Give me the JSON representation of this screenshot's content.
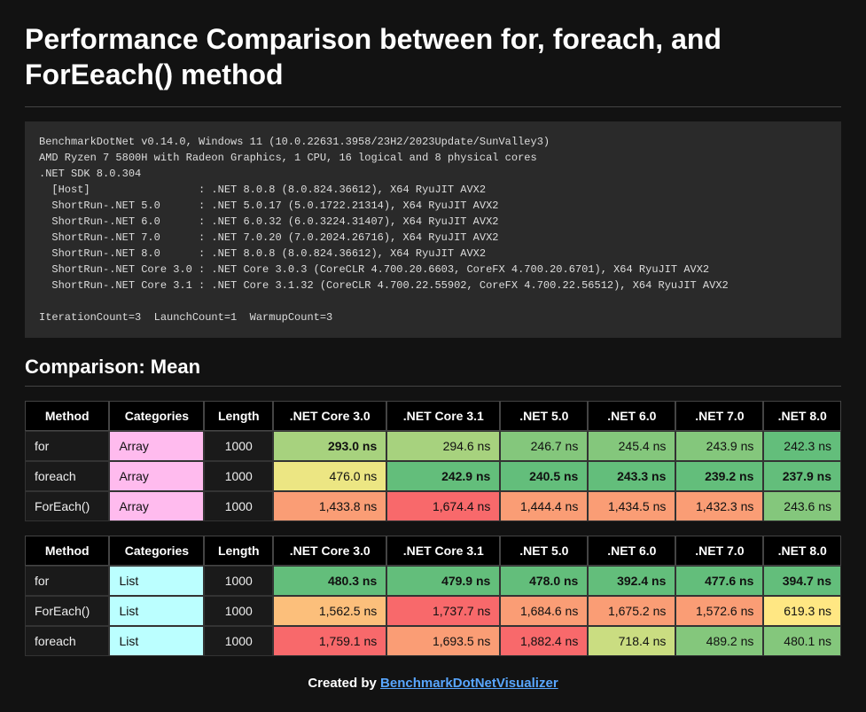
{
  "title": "Performance Comparison between for, foreach, and ForEeach() method",
  "environment_text": "BenchmarkDotNet v0.14.0, Windows 11 (10.0.22631.3958/23H2/2023Update/SunValley3)\nAMD Ryzen 7 5800H with Radeon Graphics, 1 CPU, 16 logical and 8 physical cores\n.NET SDK 8.0.304\n  [Host]                 : .NET 8.0.8 (8.0.824.36612), X64 RyuJIT AVX2\n  ShortRun-.NET 5.0      : .NET 5.0.17 (5.0.1722.21314), X64 RyuJIT AVX2\n  ShortRun-.NET 6.0      : .NET 6.0.32 (6.0.3224.31407), X64 RyuJIT AVX2\n  ShortRun-.NET 7.0      : .NET 7.0.20 (7.0.2024.26716), X64 RyuJIT AVX2\n  ShortRun-.NET 8.0      : .NET 8.0.8 (8.0.824.36612), X64 RyuJIT AVX2\n  ShortRun-.NET Core 3.0 : .NET Core 3.0.3 (CoreCLR 4.700.20.6603, CoreFX 4.700.20.6701), X64 RyuJIT AVX2\n  ShortRun-.NET Core 3.1 : .NET Core 3.1.32 (CoreCLR 4.700.22.55902, CoreFX 4.700.22.56512), X64 RyuJIT AVX2\n\nIterationCount=3  LaunchCount=1  WarmupCount=3",
  "comparison_heading": "Comparison: Mean",
  "headers": {
    "method": "Method",
    "categories": "Categories",
    "length": "Length",
    "runtimes": [
      ".NET Core 3.0",
      ".NET Core 3.1",
      ".NET 5.0",
      ".NET 6.0",
      ".NET 7.0",
      ".NET 8.0"
    ]
  },
  "colors": {
    "heat": [
      "#63be7b",
      "#84c77c",
      "#a7d27e",
      "#cadd81",
      "#ece683",
      "#ffe783",
      "#fcbf7b",
      "#fa9d75",
      "#f8696b"
    ]
  },
  "tables": [
    {
      "category_class": "cat-array",
      "rows": [
        {
          "method": "for",
          "category": "Array",
          "length": "1000",
          "cells": [
            {
              "text": "293.0 ns",
              "bold": true,
              "heat": 2
            },
            {
              "text": "294.6 ns",
              "bold": false,
              "heat": 2
            },
            {
              "text": "246.7 ns",
              "bold": false,
              "heat": 1
            },
            {
              "text": "245.4 ns",
              "bold": false,
              "heat": 1
            },
            {
              "text": "243.9 ns",
              "bold": false,
              "heat": 1
            },
            {
              "text": "242.3 ns",
              "bold": false,
              "heat": 0
            }
          ]
        },
        {
          "method": "foreach",
          "category": "Array",
          "length": "1000",
          "cells": [
            {
              "text": "476.0 ns",
              "bold": false,
              "heat": 4
            },
            {
              "text": "242.9 ns",
              "bold": true,
              "heat": 0
            },
            {
              "text": "240.5 ns",
              "bold": true,
              "heat": 0
            },
            {
              "text": "243.3 ns",
              "bold": true,
              "heat": 0
            },
            {
              "text": "239.2 ns",
              "bold": true,
              "heat": 0
            },
            {
              "text": "237.9 ns",
              "bold": true,
              "heat": 0
            }
          ]
        },
        {
          "method": "ForEach()",
          "category": "Array",
          "length": "1000",
          "cells": [
            {
              "text": "1,433.8 ns",
              "bold": false,
              "heat": 7
            },
            {
              "text": "1,674.4 ns",
              "bold": false,
              "heat": 8
            },
            {
              "text": "1,444.4 ns",
              "bold": false,
              "heat": 7
            },
            {
              "text": "1,434.5 ns",
              "bold": false,
              "heat": 7
            },
            {
              "text": "1,432.3 ns",
              "bold": false,
              "heat": 7
            },
            {
              "text": "243.6 ns",
              "bold": false,
              "heat": 1
            }
          ]
        }
      ]
    },
    {
      "category_class": "cat-list",
      "rows": [
        {
          "method": "for",
          "category": "List",
          "length": "1000",
          "cells": [
            {
              "text": "480.3 ns",
              "bold": true,
              "heat": 0
            },
            {
              "text": "479.9 ns",
              "bold": true,
              "heat": 0
            },
            {
              "text": "478.0 ns",
              "bold": true,
              "heat": 0
            },
            {
              "text": "392.4 ns",
              "bold": true,
              "heat": 0
            },
            {
              "text": "477.6 ns",
              "bold": true,
              "heat": 0
            },
            {
              "text": "394.7 ns",
              "bold": true,
              "heat": 0
            }
          ]
        },
        {
          "method": "ForEach()",
          "category": "List",
          "length": "1000",
          "cells": [
            {
              "text": "1,562.5 ns",
              "bold": false,
              "heat": 6
            },
            {
              "text": "1,737.7 ns",
              "bold": false,
              "heat": 8
            },
            {
              "text": "1,684.6 ns",
              "bold": false,
              "heat": 7
            },
            {
              "text": "1,675.2 ns",
              "bold": false,
              "heat": 7
            },
            {
              "text": "1,572.6 ns",
              "bold": false,
              "heat": 7
            },
            {
              "text": "619.3 ns",
              "bold": false,
              "heat": 5
            }
          ]
        },
        {
          "method": "foreach",
          "category": "List",
          "length": "1000",
          "cells": [
            {
              "text": "1,759.1 ns",
              "bold": false,
              "heat": 8
            },
            {
              "text": "1,693.5 ns",
              "bold": false,
              "heat": 7
            },
            {
              "text": "1,882.4 ns",
              "bold": false,
              "heat": 8
            },
            {
              "text": "718.4 ns",
              "bold": false,
              "heat": 3
            },
            {
              "text": "489.2 ns",
              "bold": false,
              "heat": 1
            },
            {
              "text": "480.1 ns",
              "bold": false,
              "heat": 1
            }
          ]
        }
      ]
    }
  ],
  "footer": {
    "prefix": "Created by ",
    "link_text": "BenchmarkDotNetVisualizer"
  }
}
